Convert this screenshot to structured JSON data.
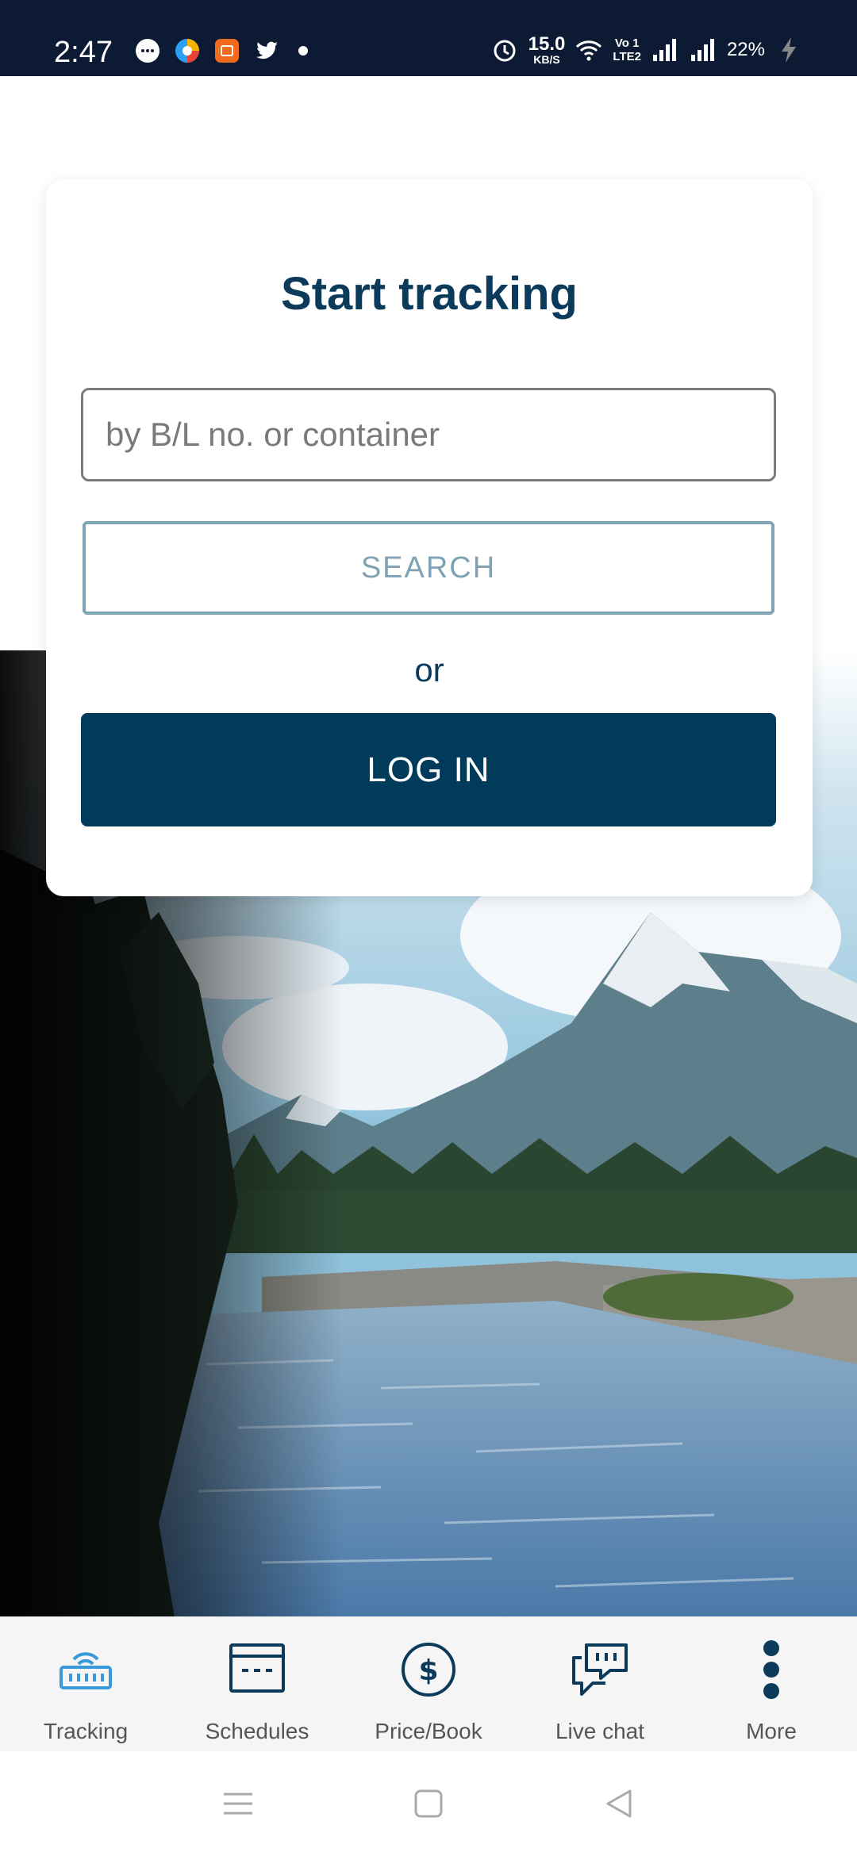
{
  "status_bar": {
    "time": "2:47",
    "network_speed": "15.0",
    "network_speed_unit": "KB/S",
    "volte_top": "Vo 1",
    "volte_bottom": "LTE2",
    "battery_percent": "22%",
    "notification_icons": [
      "chat-bubble-icon",
      "browser-icon",
      "app-icon",
      "twitter-icon"
    ]
  },
  "card": {
    "title": "Start tracking",
    "input_placeholder": "by B/L no. or container",
    "search_label": "SEARCH",
    "or_text": "or",
    "login_label": "LOG IN"
  },
  "bottom_nav": {
    "items": [
      {
        "label": "Tracking",
        "icon": "tracking-icon",
        "active": true
      },
      {
        "label": "Schedules",
        "icon": "schedules-icon"
      },
      {
        "label": "Price/Book",
        "icon": "price-icon"
      },
      {
        "label": "Live chat",
        "icon": "chat-icon"
      },
      {
        "label": "More",
        "icon": "more-icon"
      }
    ]
  },
  "colors": {
    "brand": "#003b5c",
    "title": "#0b3a5b",
    "search_border": "#7fa3b5",
    "active_nav": "#3a9ad9",
    "status_bar": "#0d1a33"
  }
}
